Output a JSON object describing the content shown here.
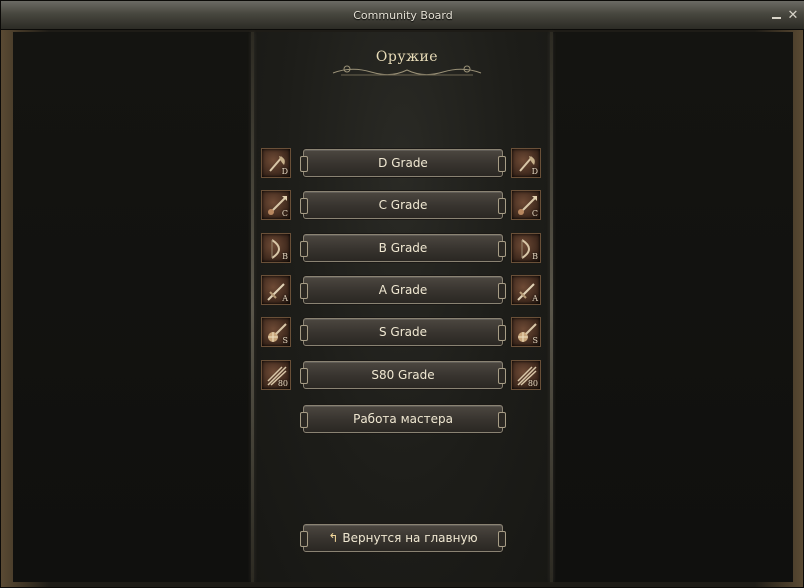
{
  "window": {
    "title": "Community Board"
  },
  "header": {
    "title": "Оружие"
  },
  "grades": [
    {
      "label": "D Grade",
      "glyph": "D",
      "icon": "axe-icon"
    },
    {
      "label": "C Grade",
      "glyph": "C",
      "icon": "spear-icon"
    },
    {
      "label": "B Grade",
      "glyph": "B",
      "icon": "bow-icon"
    },
    {
      "label": "A Grade",
      "glyph": "A",
      "icon": "sword-icon"
    },
    {
      "label": "S Grade",
      "glyph": "S",
      "icon": "mace-icon"
    },
    {
      "label": "S80 Grade",
      "glyph": "80",
      "icon": "claw-icon"
    }
  ],
  "master_work": {
    "label": "Работа мастера"
  },
  "back": {
    "label": "Вернутся на главную",
    "icon": "back-arrow-icon"
  }
}
